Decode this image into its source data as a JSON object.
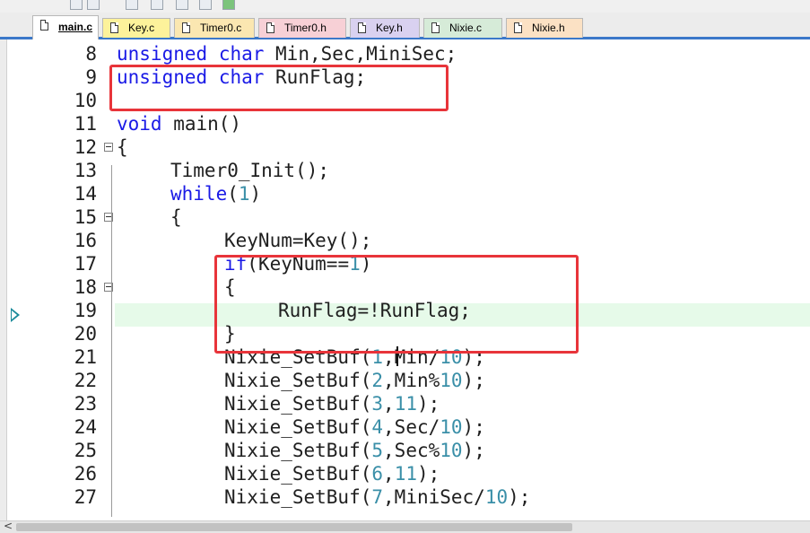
{
  "tabs": [
    {
      "label": "main.c",
      "color": "#ffffff",
      "active": true
    },
    {
      "label": "Key.c",
      "color": "#fdf29b",
      "active": false
    },
    {
      "label": "Timer0.c",
      "color": "#fbe7b1",
      "active": false
    },
    {
      "label": "Timer0.h",
      "color": "#f7d0d6",
      "active": false
    },
    {
      "label": "Key.h",
      "color": "#d9d1f0",
      "active": false
    },
    {
      "label": "Nixie.c",
      "color": "#d6ebd8",
      "active": false
    },
    {
      "label": "Nixie.h",
      "color": "#fbe1c4",
      "active": false
    }
  ],
  "code_lines": [
    {
      "n": "8",
      "fold": false,
      "indent": 0,
      "tokens": [
        {
          "t": "unsigned",
          "c": "kw"
        },
        {
          "t": " "
        },
        {
          "t": "char",
          "c": "kw"
        },
        {
          "t": " Min,Sec,MiniSec;"
        }
      ]
    },
    {
      "n": "9",
      "fold": false,
      "indent": 0,
      "tokens": [
        {
          "t": "unsigned",
          "c": "kw"
        },
        {
          "t": " "
        },
        {
          "t": "char",
          "c": "kw"
        },
        {
          "t": " RunFlag;"
        }
      ]
    },
    {
      "n": "10",
      "fold": false,
      "indent": 0,
      "tokens": []
    },
    {
      "n": "11",
      "fold": false,
      "indent": 0,
      "tokens": [
        {
          "t": "void",
          "c": "kw"
        },
        {
          "t": " main()"
        }
      ]
    },
    {
      "n": "12",
      "fold": true,
      "indent": 0,
      "tokens": [
        {
          "t": "{"
        }
      ]
    },
    {
      "n": "13",
      "fold": false,
      "indent": 1,
      "tokens": [
        {
          "t": "Timer0_Init();"
        }
      ]
    },
    {
      "n": "14",
      "fold": false,
      "indent": 1,
      "tokens": [
        {
          "t": "while",
          "c": "kw"
        },
        {
          "t": "("
        },
        {
          "t": "1",
          "c": "num"
        },
        {
          "t": ")"
        }
      ]
    },
    {
      "n": "15",
      "fold": true,
      "indent": 1,
      "tokens": [
        {
          "t": "{"
        }
      ]
    },
    {
      "n": "16",
      "fold": false,
      "indent": 2,
      "tokens": [
        {
          "t": "KeyNum=Key();"
        }
      ]
    },
    {
      "n": "17",
      "fold": false,
      "indent": 2,
      "tokens": [
        {
          "t": "if",
          "c": "kw"
        },
        {
          "t": "(KeyNum=="
        },
        {
          "t": "1",
          "c": "num"
        },
        {
          "t": ")"
        }
      ]
    },
    {
      "n": "18",
      "fold": true,
      "indent": 2,
      "tokens": [
        {
          "t": "{"
        }
      ]
    },
    {
      "n": "19",
      "fold": false,
      "indent": 3,
      "tokens": [
        {
          "t": "RunFlag=!RunFlag;"
        }
      ]
    },
    {
      "n": "20",
      "fold": false,
      "indent": 2,
      "tokens": [
        {
          "t": "}"
        }
      ]
    },
    {
      "n": "21",
      "fold": false,
      "indent": 2,
      "tokens": [
        {
          "t": "Nixie_SetBuf("
        },
        {
          "t": "1",
          "c": "num"
        },
        {
          "t": ",Min/"
        },
        {
          "t": "10",
          "c": "num"
        },
        {
          "t": ");"
        }
      ]
    },
    {
      "n": "22",
      "fold": false,
      "indent": 2,
      "tokens": [
        {
          "t": "Nixie_SetBuf("
        },
        {
          "t": "2",
          "c": "num"
        },
        {
          "t": ",Min%"
        },
        {
          "t": "10",
          "c": "num"
        },
        {
          "t": ");"
        }
      ]
    },
    {
      "n": "23",
      "fold": false,
      "indent": 2,
      "tokens": [
        {
          "t": "Nixie_SetBuf("
        },
        {
          "t": "3",
          "c": "num"
        },
        {
          "t": ","
        },
        {
          "t": "11",
          "c": "num"
        },
        {
          "t": ");"
        }
      ]
    },
    {
      "n": "24",
      "fold": false,
      "indent": 2,
      "tokens": [
        {
          "t": "Nixie_SetBuf("
        },
        {
          "t": "4",
          "c": "num"
        },
        {
          "t": ",Sec/"
        },
        {
          "t": "10",
          "c": "num"
        },
        {
          "t": ");"
        }
      ]
    },
    {
      "n": "25",
      "fold": false,
      "indent": 2,
      "tokens": [
        {
          "t": "Nixie_SetBuf("
        },
        {
          "t": "5",
          "c": "num"
        },
        {
          "t": ",Sec%"
        },
        {
          "t": "10",
          "c": "num"
        },
        {
          "t": ");"
        }
      ]
    },
    {
      "n": "26",
      "fold": false,
      "indent": 2,
      "tokens": [
        {
          "t": "Nixie_SetBuf("
        },
        {
          "t": "6",
          "c": "num"
        },
        {
          "t": ","
        },
        {
          "t": "11",
          "c": "num"
        },
        {
          "t": ");"
        }
      ]
    },
    {
      "n": "27",
      "fold": false,
      "indent": 2,
      "tokens": [
        {
          "t": "Nixie_SetBuf("
        },
        {
          "t": "7",
          "c": "num"
        },
        {
          "t": ",MiniSec/"
        },
        {
          "t": "10",
          "c": "num"
        },
        {
          "t": ");"
        }
      ]
    }
  ],
  "current_line": "19",
  "icons": {
    "execution_arrow": "current-line-arrow-icon",
    "fold": "fold-minus-icon",
    "file": "file-icon",
    "scroll_left": "scroll-left-arrow-icon"
  },
  "scroll_left_glyph": "<",
  "colors": {
    "keyword": "#1a1ae6",
    "number": "#3a8fa8",
    "highlight_box": "#e8343a",
    "current_line_bg": "#e6fae9",
    "tab_underline": "#3b78c9"
  }
}
